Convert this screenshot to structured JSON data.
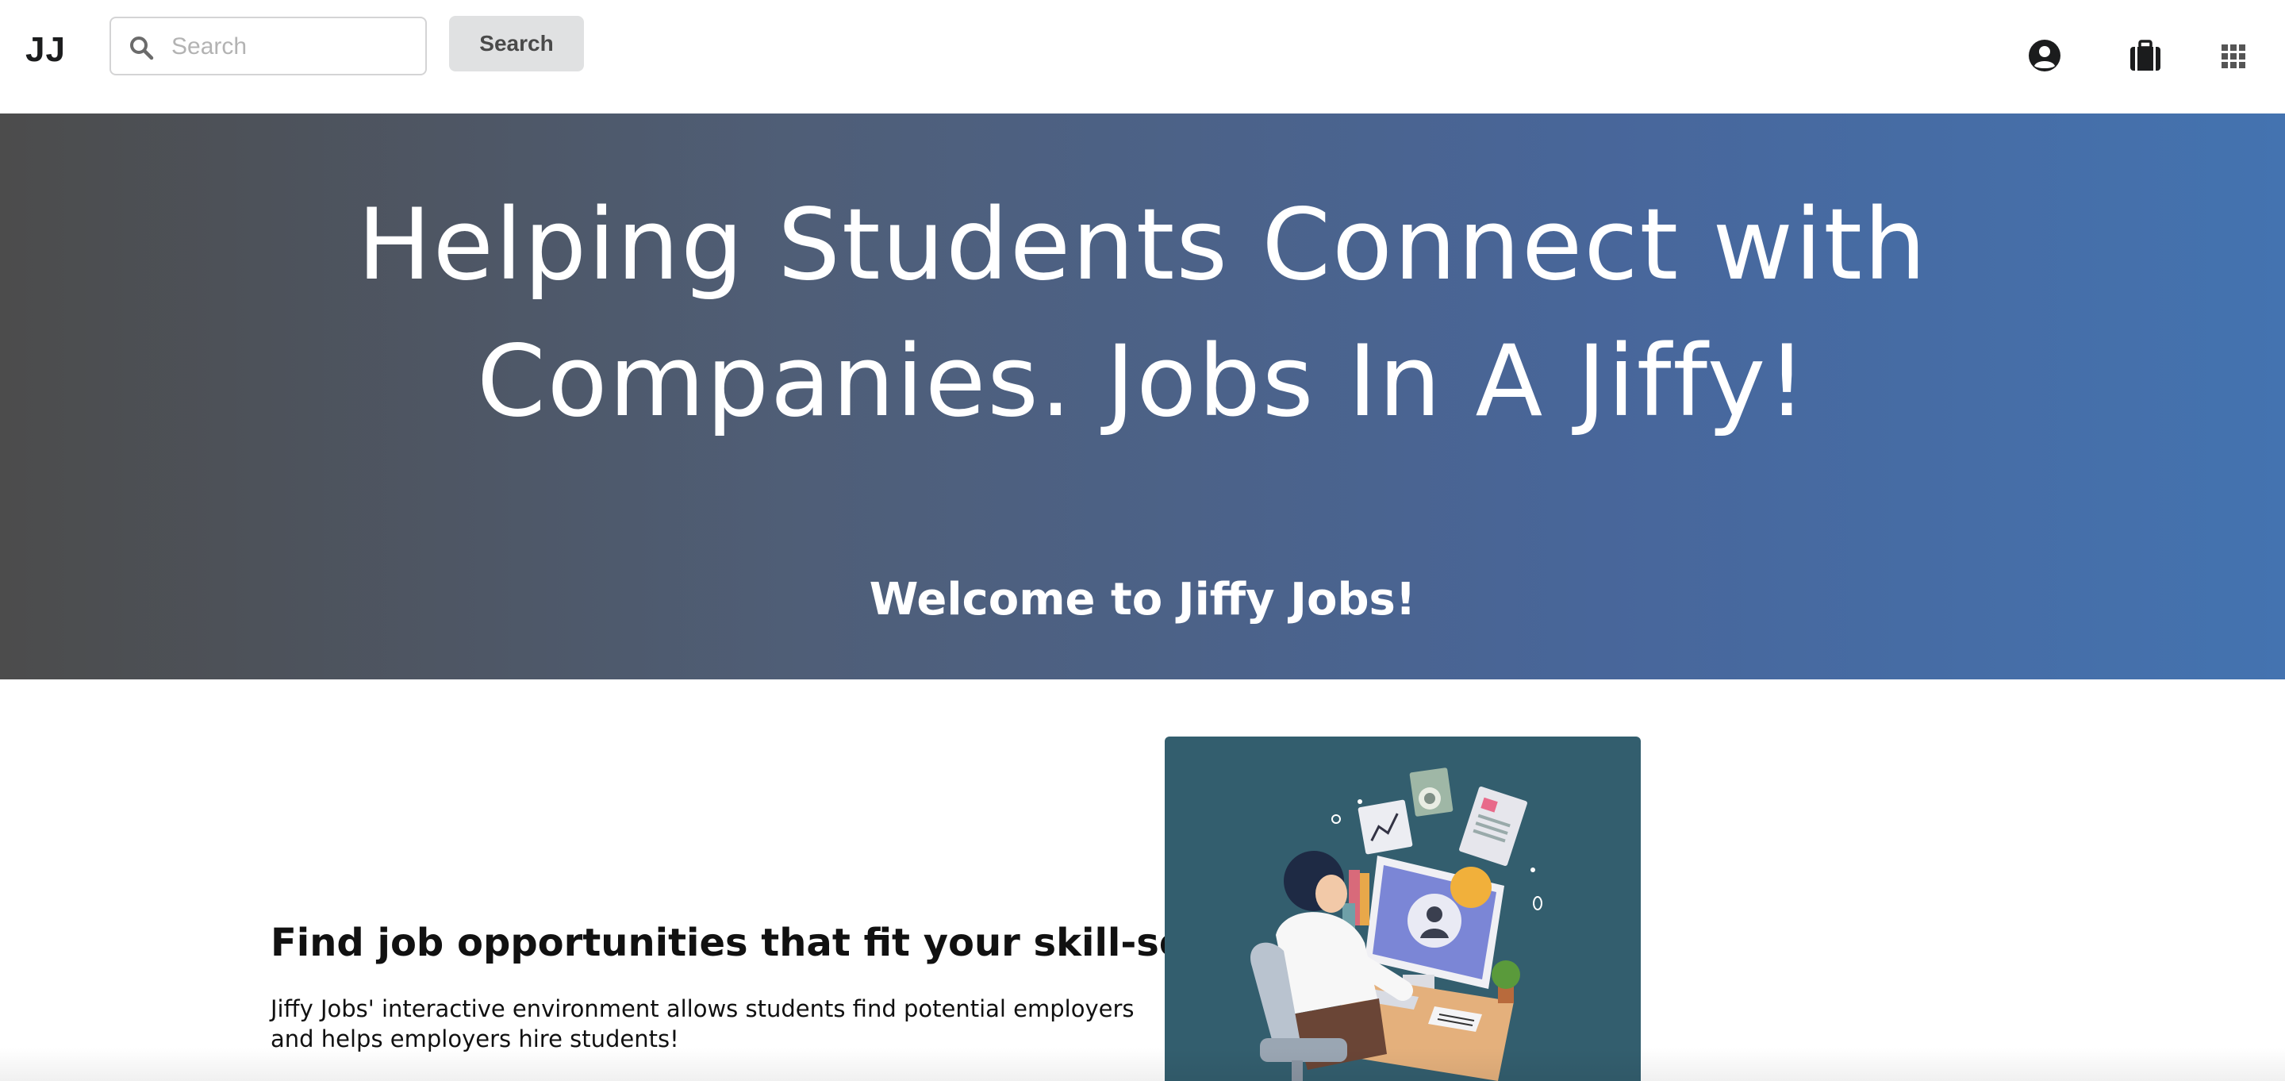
{
  "header": {
    "logo": "JJ",
    "search": {
      "placeholder": "Search",
      "value": ""
    },
    "search_button_label": "Search",
    "icons": [
      "user-circle-icon",
      "briefcase-icon",
      "grid-icon"
    ]
  },
  "hero": {
    "title_line1": "Helping Students Connect with",
    "title_line2": "Companies. Jobs In A Jiffy!",
    "subtitle": "Welcome to Jiffy Jobs!"
  },
  "feature": {
    "heading": "Find job opportunities that fit your skill-set",
    "text_line1": "Jiffy Jobs' interactive environment allows students find potential employers",
    "text_line2": "and helps employers hire students!",
    "illustration": "person-at-computer-illustration"
  },
  "colors": {
    "hero_gradient_start": "#4c4c4c",
    "hero_gradient_end": "#4473b0",
    "illustration_bg": "#335e6e",
    "button_bg": "#e0e1e2"
  }
}
